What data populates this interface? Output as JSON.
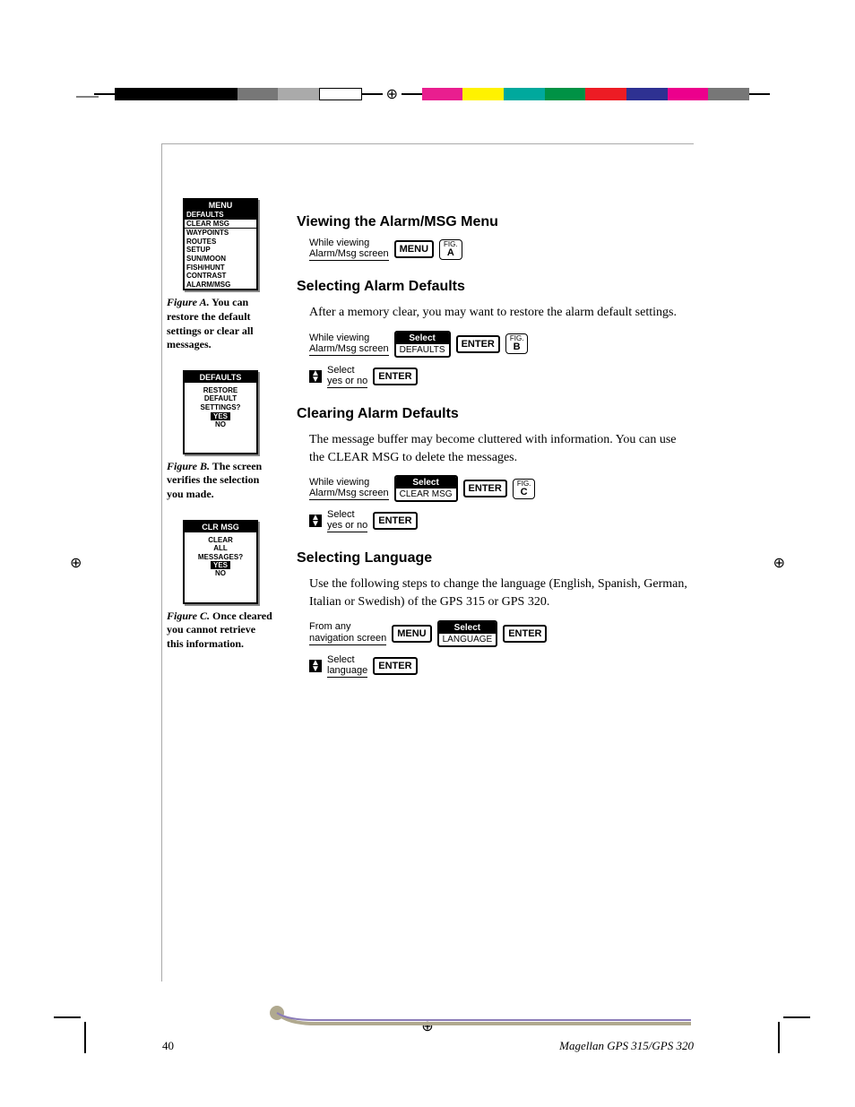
{
  "colors": [
    "#000",
    "#000",
    "#000",
    "#777",
    "#aaa",
    "#fff",
    "#e91e8f",
    "#fff200",
    "#00a99d",
    "#009245",
    "#ed1c24",
    "#2e3192",
    "#ec008c",
    "#666"
  ],
  "lcd_a": {
    "title": "MENU",
    "sel1": "DEFAULTS",
    "row2": "CLEAR MSG",
    "rows": [
      "WAYPOINTS",
      "ROUTES",
      "SETUP",
      "SUN/MOON",
      "FISH/HUNT",
      "CONTRAST",
      "ALARM/MSG"
    ]
  },
  "cap_a": {
    "fig": "Figure A.",
    "text": " You can restore the default settings or clear all messages."
  },
  "lcd_b": {
    "title": "DEFAULTS",
    "l1": "RESTORE",
    "l2": "DEFAULT",
    "l3": "SETTINGS?",
    "yes": "YES",
    "no": "NO"
  },
  "cap_b": {
    "fig": "Figure B.",
    "text": "  The screen verifies the selection you made."
  },
  "lcd_c": {
    "title": "CLR MSG",
    "l1": "CLEAR",
    "l2": "ALL",
    "l3": "MESSAGES?",
    "yes": "YES",
    "no": "NO"
  },
  "cap_c": {
    "fig": "Figure C.",
    "text": "  Once cleared you cannot retrieve this information."
  },
  "s1": {
    "h": "Viewing the Alarm/MSG Menu",
    "t1": "While viewing",
    "t2": "Alarm/Msg screen",
    "menu": "MENU",
    "fig": "FIG.",
    "figL": "A"
  },
  "s2": {
    "h": "Selecting Alarm Defaults",
    "body": "After a memory clear, you may want to restore the alarm default settings.",
    "t1": "While viewing",
    "t2": "Alarm/Msg screen",
    "sel": "Select",
    "opt": "DEFAULTS",
    "enter": "ENTER",
    "fig": "FIG.",
    "figL": "B",
    "r2a": "Select",
    "r2b": "yes or no"
  },
  "s3": {
    "h": "Clearing Alarm Defaults",
    "body": "The message buffer may become cluttered with information. You can use the CLEAR MSG to delete the messages.",
    "t1": "While viewing",
    "t2": "Alarm/Msg screen",
    "sel": "Select",
    "opt": "CLEAR MSG",
    "enter": "ENTER",
    "fig": "FIG.",
    "figL": "C",
    "r2a": "Select",
    "r2b": "yes or no"
  },
  "s4": {
    "h": "Selecting Language",
    "body": "Use the following steps to change the language (English, Spanish, German, Italian or Swedish) of the GPS 315 or GPS 320.",
    "t1": "From any",
    "t2": "navigation screen",
    "menu": "MENU",
    "sel": "Select",
    "opt": "LANGUAGE",
    "enter": "ENTER",
    "r2a": "Select",
    "r2b": "language"
  },
  "footer": {
    "page": "40",
    "book": "Magellan GPS 315/GPS 320"
  }
}
